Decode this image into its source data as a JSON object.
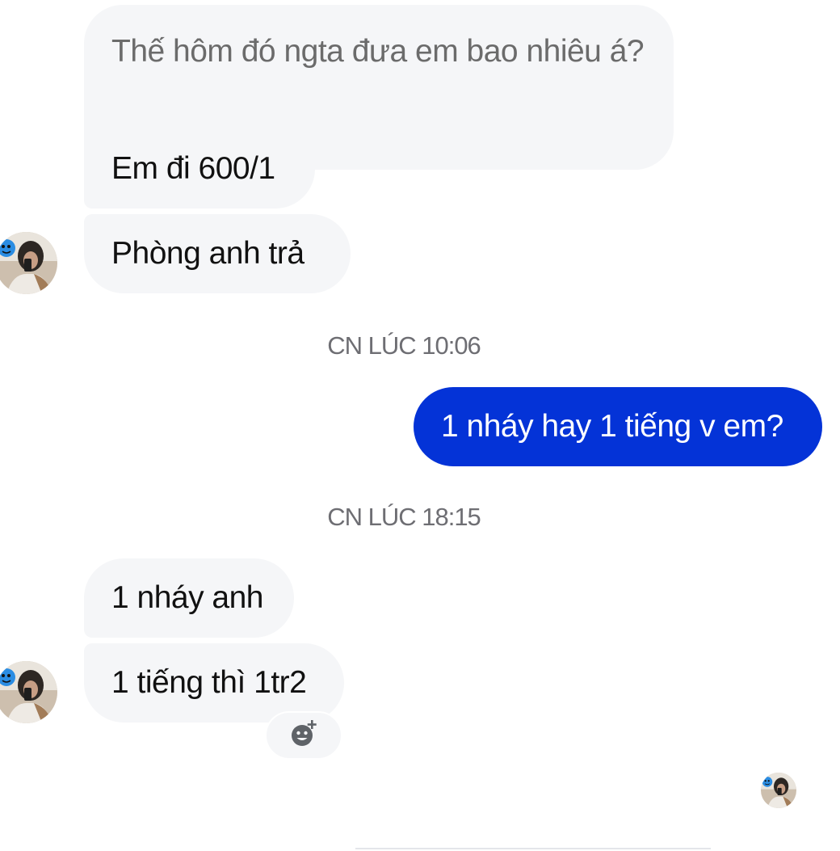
{
  "messages": [
    {
      "text": "Thế hôm đó ngta đưa em bao nhiêu á?",
      "direction": "incoming"
    },
    {
      "text": "Em đi 600/1",
      "direction": "incoming"
    },
    {
      "text": "Phòng anh trả",
      "direction": "incoming"
    },
    {
      "text": "1 nháy hay 1 tiếng v em?",
      "direction": "outgoing"
    },
    {
      "text": "1 nháy anh",
      "direction": "incoming"
    },
    {
      "text": "1 tiếng thì 1tr2",
      "direction": "incoming"
    }
  ],
  "timestamps": [
    "CN LÚC 10:06",
    "CN LÚC 18:15"
  ],
  "icons": {
    "reaction": "add-reaction-icon",
    "avatar": "contact-avatar-icon",
    "seen": "seen-avatar-icon"
  },
  "colors": {
    "incoming_bubble": "#f5f6f8",
    "outgoing_bubble": "#0433d7",
    "timestamp": "#6e6e73"
  }
}
